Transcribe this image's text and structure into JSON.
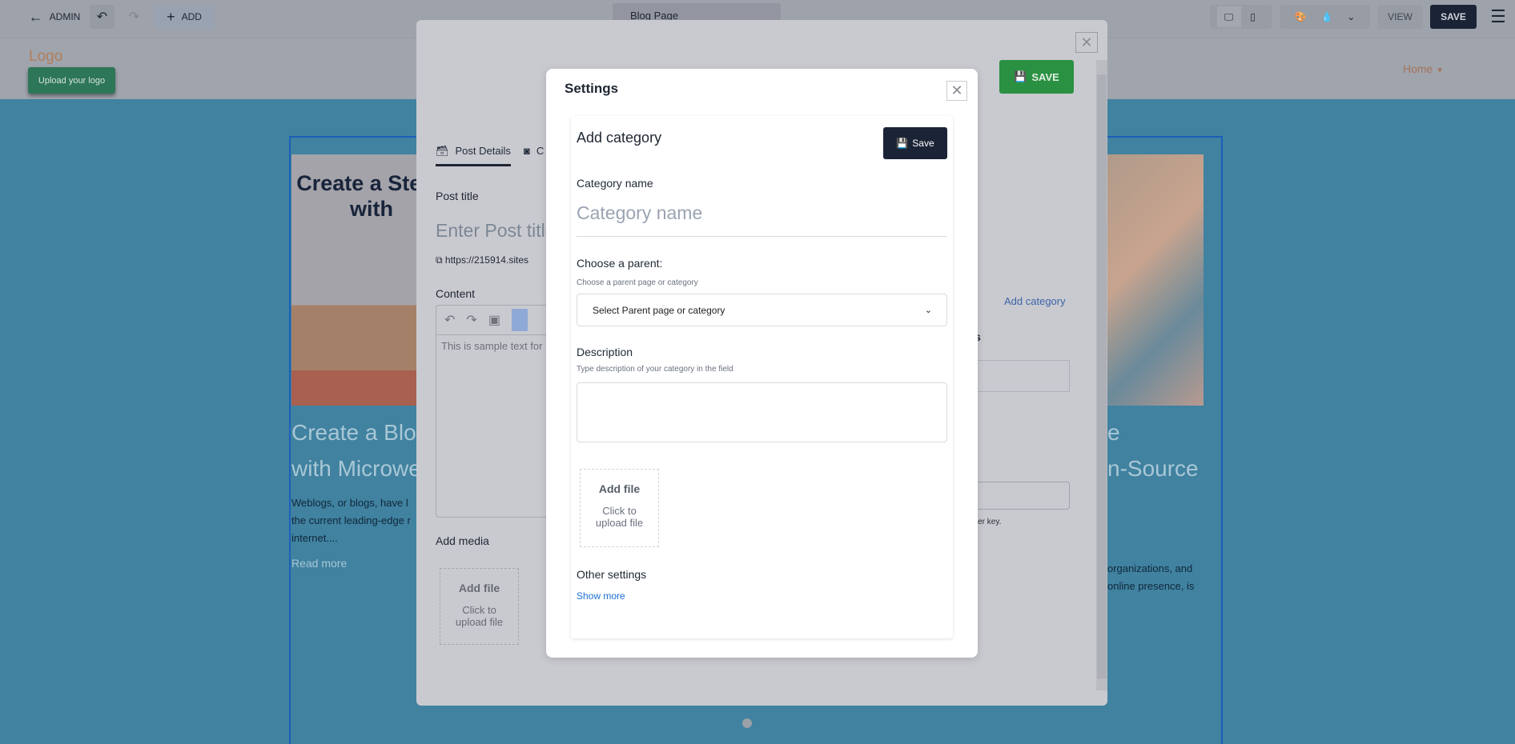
{
  "topbar": {
    "admin_label": "ADMIN",
    "add_label": "ADD",
    "page_select": "Blog Page",
    "view_label": "VIEW",
    "save_label": "SAVE"
  },
  "page": {
    "logo_text": "Logo",
    "upload_logo": "Upload your logo",
    "nav_home": "Home",
    "post1": {
      "image_text": "Create a Steps with",
      "title_line1": "Create a Blog",
      "title_line2": "with Microwe",
      "excerpt_lines": [
        "Weblogs, or blogs, have l",
        "the current leading-edge r",
        "internet...."
      ],
      "read_more": "Read more"
    },
    "post2": {
      "title_fragment1": "e",
      "title_fragment2": "n-Source",
      "excerpt_lines": [
        "organizations, and",
        "online presence, is"
      ]
    }
  },
  "post_editor": {
    "save_label": "SAVE",
    "tabs": [
      {
        "label": "Post Details"
      },
      {
        "label": "C"
      }
    ],
    "post_title_label": "Post title",
    "post_title_placeholder": "Enter Post title",
    "url": "https://215914.sites",
    "content_label": "Content",
    "content_text": "This is sample text for",
    "add_media_label": "Add media",
    "add_file": "Add file",
    "click_upload": "Click to upload file",
    "add_category_link": "Add category",
    "categories_fragment": "ries",
    "enter_key_hint": "r Enter key."
  },
  "settings": {
    "title": "Settings",
    "add_category": {
      "title": "Add category",
      "save_label": "Save",
      "name_label": "Category name",
      "name_placeholder": "Category name",
      "parent_label": "Choose a parent:",
      "parent_sub": "Choose a parent page or category",
      "parent_select": "Select Parent page or category",
      "description_label": "Description",
      "description_sub": "Type description of your category in the field",
      "add_file": "Add file",
      "click_upload": "Click to upload file",
      "other_settings": "Other settings",
      "show_more": "Show more"
    }
  },
  "colors": {
    "accent_green": "#2a9142",
    "dark_button": "#1b2436",
    "link_blue": "#1a6fd6",
    "page_blue": "#4082a0"
  }
}
